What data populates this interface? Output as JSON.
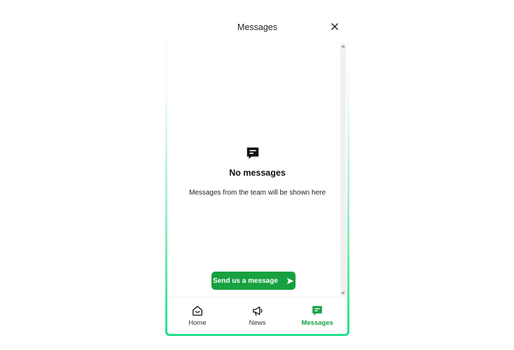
{
  "header": {
    "title": "Messages",
    "close_icon": "close-icon"
  },
  "empty_state": {
    "icon": "message-icon",
    "title": "No messages",
    "subtitle": "Messages from the team will be shown here"
  },
  "send_button": {
    "label": "Send us a message",
    "icon": "send-icon"
  },
  "nav": {
    "items": [
      {
        "label": "Home",
        "icon": "home-icon",
        "active": false
      },
      {
        "label": "News",
        "icon": "megaphone-icon",
        "active": false
      },
      {
        "label": "Messages",
        "icon": "message-icon",
        "active": true
      }
    ]
  },
  "colors": {
    "accent": "#17a140",
    "border_gradient_end": "#22e08a"
  }
}
